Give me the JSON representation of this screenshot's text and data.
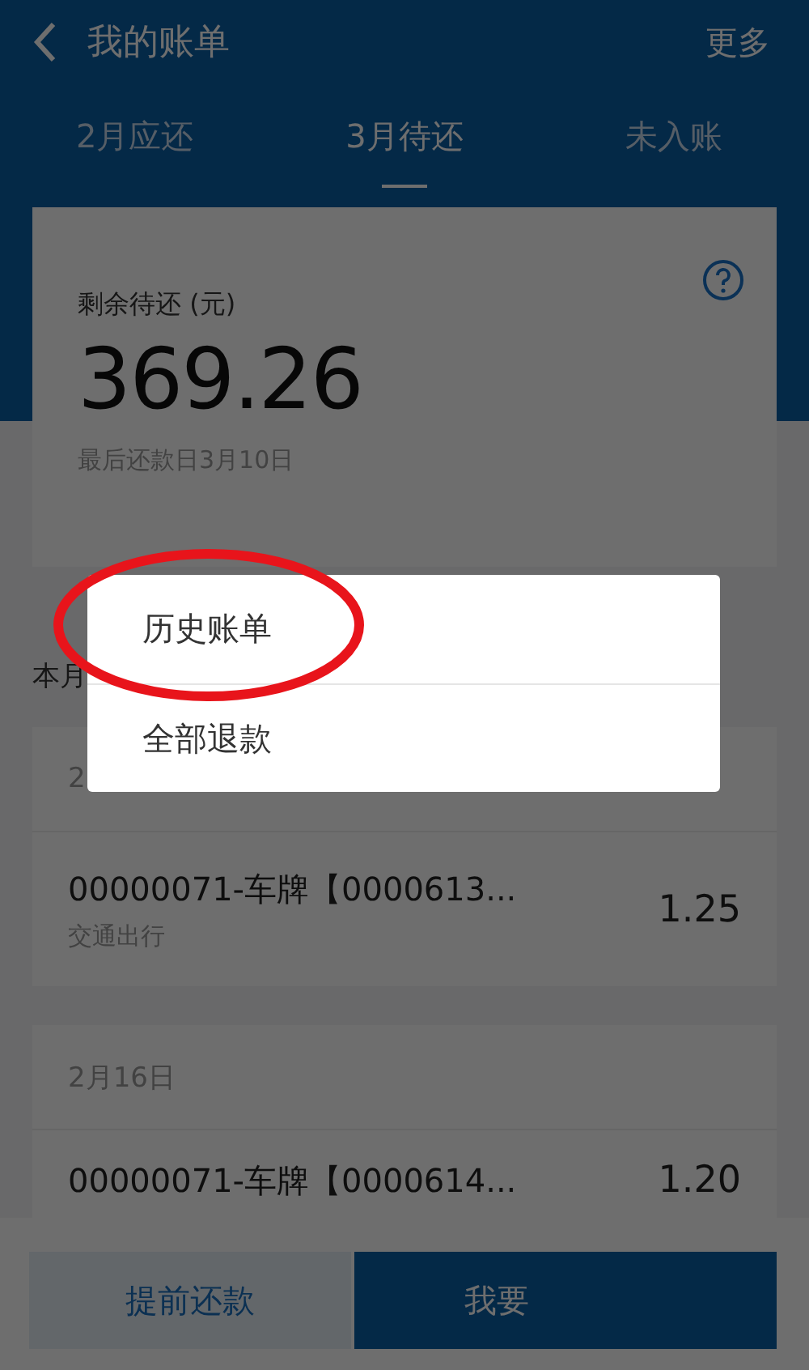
{
  "header": {
    "title": "我的账单",
    "action": "更多"
  },
  "tabs": [
    {
      "label": "2月应还",
      "selected": false
    },
    {
      "label": "3月待还",
      "selected": true
    },
    {
      "label": "未入账",
      "selected": false
    }
  ],
  "summary": {
    "label": "剩余待还 (元)",
    "amount": "369.26",
    "due": "最后还款日3月10日"
  },
  "section_title": "本月",
  "groups": [
    {
      "date": "2",
      "items": [
        {
          "title": "00000071-车牌【0000613...",
          "category": "交通出行",
          "amount": "1.25"
        }
      ]
    },
    {
      "date": "2月16日",
      "items": [
        {
          "title": "00000071-车牌【0000614...",
          "amount": "1.20"
        }
      ]
    }
  ],
  "buttons": [
    {
      "label": "提前还款",
      "kind": "secondary"
    },
    {
      "label": "我要",
      "kind": "primary"
    }
  ],
  "menu": {
    "items": [
      {
        "label": "历史账单",
        "highlighted": true
      },
      {
        "label": "全部退款",
        "highlighted": false
      }
    ]
  }
}
